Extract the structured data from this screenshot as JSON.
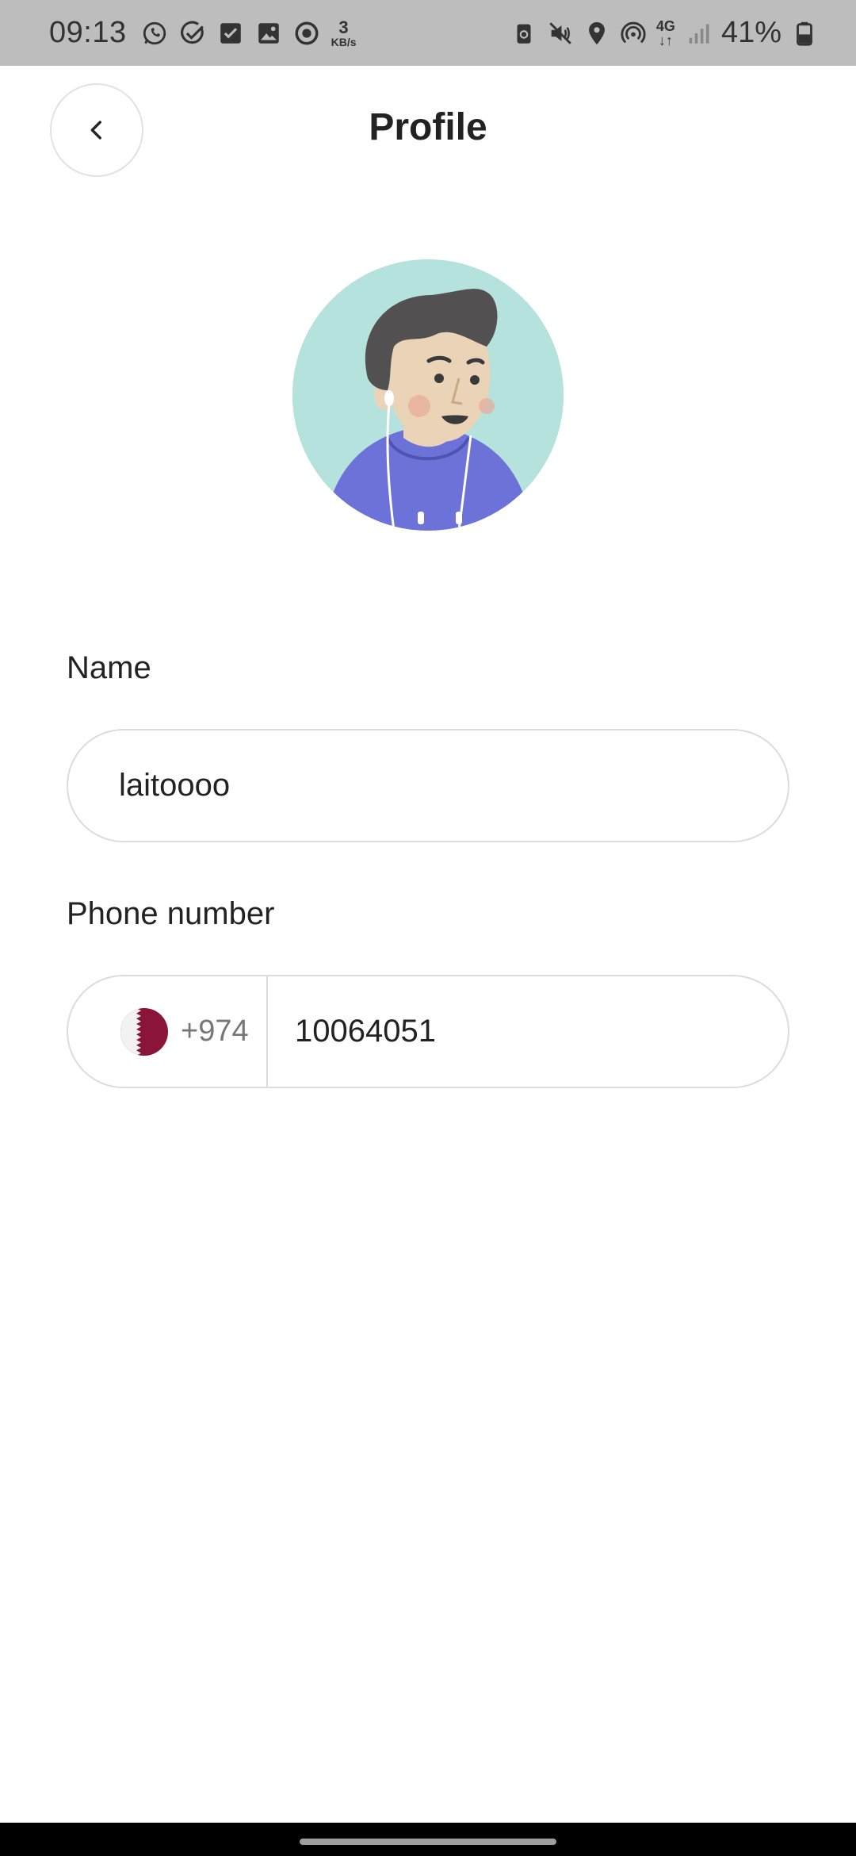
{
  "status_bar": {
    "time": "09:13",
    "speed_value": "3",
    "speed_unit": "KB/s",
    "network_type": "4G",
    "battery": "41%",
    "icons": [
      "whatsapp-icon",
      "check-circle-icon",
      "checkbox-icon",
      "gallery-icon",
      "sync-icon",
      "vpn-lock-icon",
      "mute-icon",
      "location-icon",
      "hotspot-icon",
      "signal-icon",
      "battery-icon"
    ]
  },
  "header": {
    "title": "Profile",
    "back_icon": "chevron-left-icon"
  },
  "avatar": {
    "icon": "avatar-illustration"
  },
  "form": {
    "name_label": "Name",
    "name_value": "laitoooo",
    "phone_label": "Phone number",
    "country_flag": "qatar-flag-icon",
    "dial_code": "+974",
    "phone_value": "10064051"
  },
  "colors": {
    "status_bar_bg": "#bdbdbd",
    "avatar_bg": "#b5e2dd",
    "hoodie": "#6c72d8",
    "qatar_maroon": "#8a1538",
    "input_border": "#dcdcdc"
  }
}
